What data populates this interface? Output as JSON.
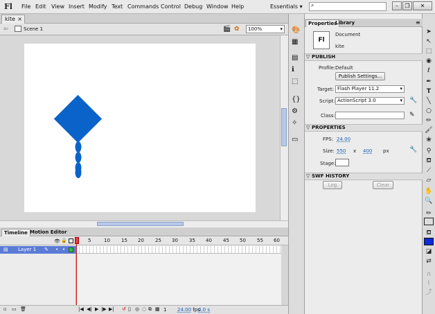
{
  "app": {
    "logo": "Fl"
  },
  "menu": [
    "File",
    "Edit",
    "View",
    "Insert",
    "Modify",
    "Text",
    "Commands",
    "Control",
    "Debug",
    "Window",
    "Help"
  ],
  "workspace": "Essentials",
  "document": {
    "tab": "kite",
    "scene": "Scene 1",
    "zoom": "100%"
  },
  "timeline": {
    "tabs": [
      "Timeline",
      "Motion Editor"
    ],
    "ruler": [
      "5",
      "10",
      "15",
      "20",
      "25",
      "30",
      "35",
      "40",
      "45",
      "50",
      "55",
      "60"
    ],
    "layer_name": "Layer 1",
    "current_frame": "1",
    "fps": "24.00",
    "fps_unit": "fps",
    "elapsed": "0.0 s"
  },
  "properties": {
    "tabs": [
      "Properties",
      "Library"
    ],
    "doc_icon": "Fl",
    "doc_type": "Document",
    "doc_name": "kite",
    "publish": {
      "title": "PUBLISH",
      "profile_label": "Profile:",
      "profile_value": "Default",
      "settings_button": "Publish Settings...",
      "target_label": "Target:",
      "target_value": "Flash Player 11.2",
      "script_label": "Script:",
      "script_value": "ActionScript 3.0",
      "class_label": "Class:"
    },
    "doc_props": {
      "title": "PROPERTIES",
      "fps_label": "FPS:",
      "fps_value": "24.00",
      "size_label": "Size:",
      "width": "550",
      "x": "x",
      "height": "400",
      "unit": "px",
      "stage_label": "Stage:"
    },
    "swf_history": {
      "title": "SWF HISTORY",
      "log": "Log",
      "clear": "Clear"
    }
  },
  "colors": {
    "kite": "#0a63c9",
    "stroke_swatch": "#2a2a2a",
    "fill_swatch": "#0b2bd6"
  }
}
